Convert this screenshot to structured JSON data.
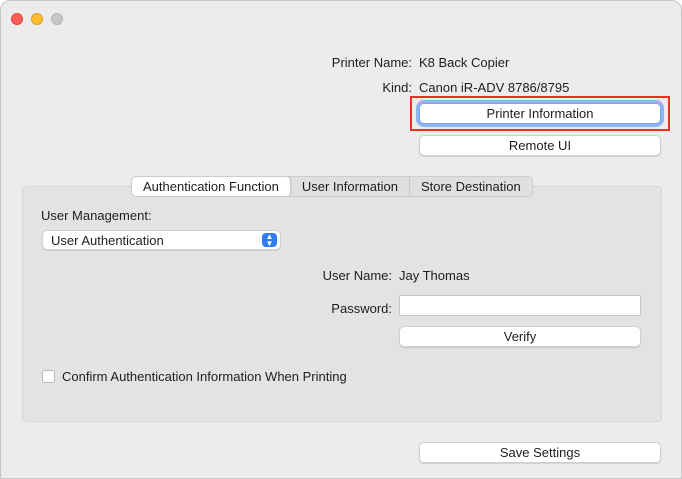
{
  "window": {
    "controls": [
      "close",
      "minimize",
      "zoom"
    ]
  },
  "printer": {
    "name_label": "Printer Name:",
    "name_value": "K8 Back Copier",
    "kind_label": "Kind:",
    "kind_value": "Canon iR-ADV 8786/8795"
  },
  "buttons": {
    "printer_information": "Printer Information",
    "remote_ui": "Remote UI",
    "verify": "Verify",
    "save_settings": "Save Settings"
  },
  "tabs": [
    {
      "label": "Authentication Function",
      "active": true
    },
    {
      "label": "User Information",
      "active": false
    },
    {
      "label": "Store Destination",
      "active": false
    }
  ],
  "auth": {
    "user_management_label": "User Management:",
    "user_management_value": "User Authentication",
    "user_name_label": "User Name:",
    "user_name_value": "Jay Thomas",
    "password_label": "Password:",
    "password_value": "",
    "confirm_checkbox_label": "Confirm Authentication Information When Printing",
    "confirm_checked": false
  },
  "colors": {
    "accent": "#2f7cf6",
    "focus_ring": "#8cb7f0",
    "highlight_box": "#e5331f"
  }
}
